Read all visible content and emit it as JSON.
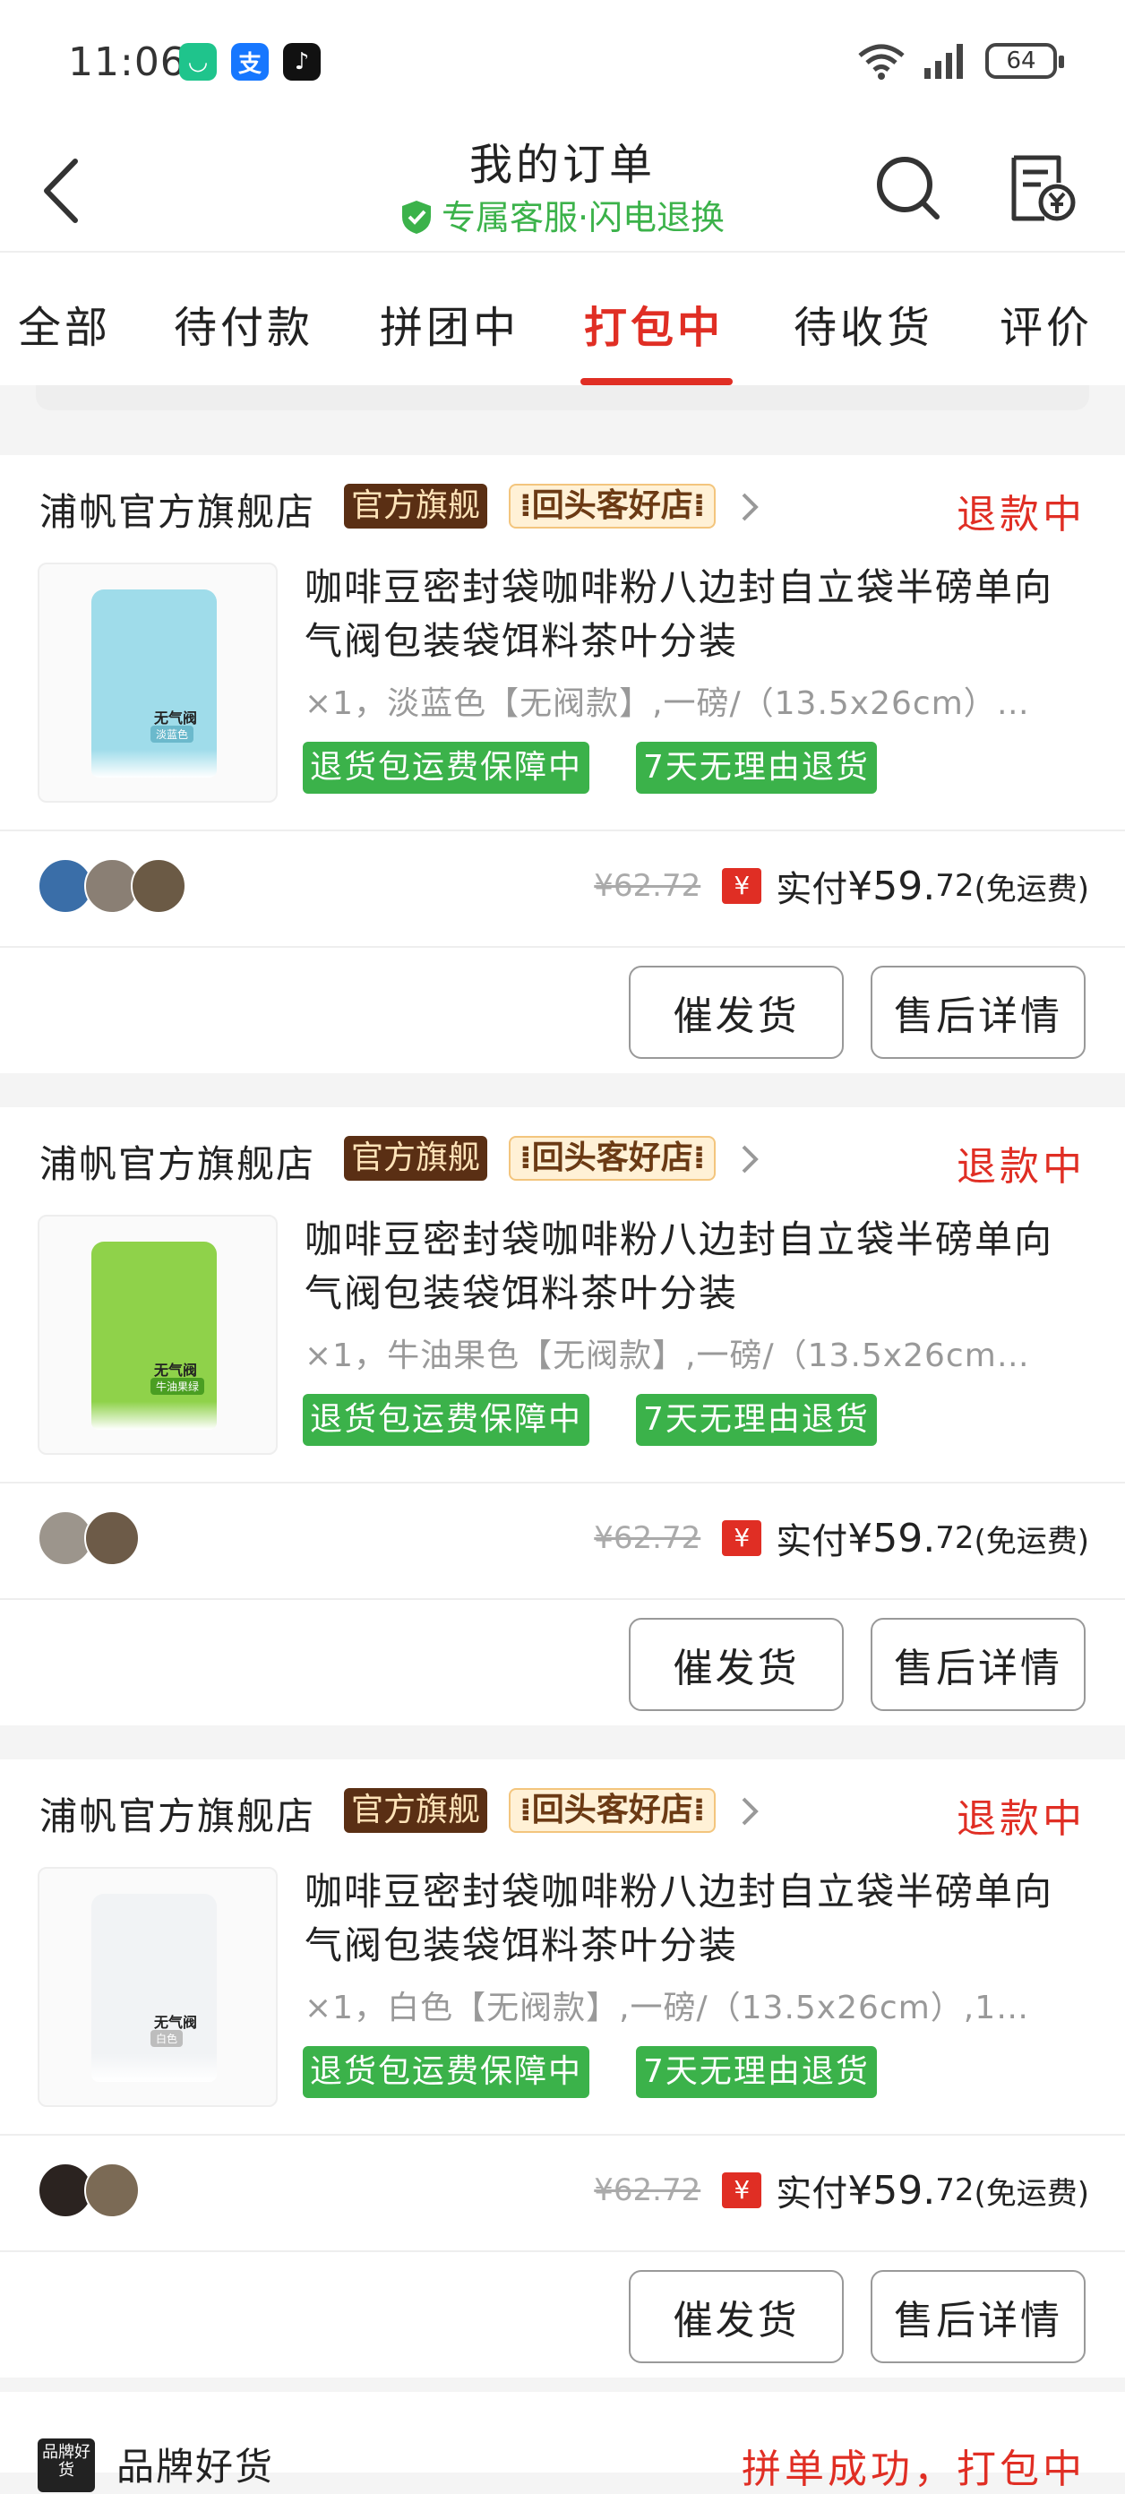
{
  "status_bar": {
    "time": "11:06",
    "apps": [
      {
        "icon": "app-icon-green",
        "glyph": "◡",
        "color": "#1fc48c"
      },
      {
        "icon": "alipay-icon",
        "glyph": "支",
        "color": "#1677ff"
      },
      {
        "icon": "tiktok-icon",
        "glyph": "♪",
        "color": "#111111"
      }
    ],
    "battery": "64"
  },
  "header": {
    "title": "我的订单",
    "subtitle": "专属客服·闪电退换"
  },
  "tabs": [
    {
      "label": "全部"
    },
    {
      "label": "待付款"
    },
    {
      "label": "拼团中"
    },
    {
      "label": "打包中"
    },
    {
      "label": "待收货"
    },
    {
      "label": "评价"
    }
  ],
  "orders": [
    {
      "store": "浦帆官方旗舰店",
      "badge_official": "官方旗舰",
      "badge_repeat": "回头客好店",
      "status": "退款中",
      "title": "咖啡豆密封袋咖啡粉八边封自立袋半磅单向气阀包装袋饵料茶叶分装",
      "spec": "×1，淡蓝色【无阀款】,一磅/（13.5x26cm）…",
      "bag_color": "#9fdcea",
      "bag_label": "无气阀",
      "bag_sub": "淡蓝色",
      "tag1": "退货包运费保障中",
      "tag2": "7天无理由退货",
      "orig_price": "¥62.72",
      "pay_label": "实付",
      "price_int": "¥59.",
      "price_dec": "72",
      "shipping": "(免运费)",
      "btn1": "催发货",
      "btn2": "售后详情"
    },
    {
      "store": "浦帆官方旗舰店",
      "badge_official": "官方旗舰",
      "badge_repeat": "回头客好店",
      "status": "退款中",
      "title": "咖啡豆密封袋咖啡粉八边封自立袋半磅单向气阀包装袋饵料茶叶分装",
      "spec": "×1，牛油果色【无阀款】,一磅/（13.5x26cm…",
      "bag_color": "#8fd24a",
      "bag_label": "无气阀",
      "bag_sub": "牛油果绿",
      "tag1": "退货包运费保障中",
      "tag2": "7天无理由退货",
      "orig_price": "¥62.72",
      "pay_label": "实付",
      "price_int": "¥59.",
      "price_dec": "72",
      "shipping": "(免运费)",
      "btn1": "催发货",
      "btn2": "售后详情"
    },
    {
      "store": "浦帆官方旗舰店",
      "badge_official": "官方旗舰",
      "badge_repeat": "回头客好店",
      "status": "退款中",
      "title": "咖啡豆密封袋咖啡粉八边封自立袋半磅单向气阀包装袋饵料茶叶分装",
      "spec": "×1，白色【无阀款】,一磅/（13.5x26cm）,1…",
      "bag_color": "#f1f3f5",
      "bag_label": "无气阀",
      "bag_sub": "白色",
      "tag1": "退货包运费保障中",
      "tag2": "7天无理由退货",
      "orig_price": "¥62.72",
      "pay_label": "实付",
      "price_int": "¥59.",
      "price_dec": "72",
      "shipping": "(免运费)",
      "btn1": "催发货",
      "btn2": "售后详情"
    }
  ],
  "partial_order": {
    "store": "品牌好货",
    "logo_text": "品牌好货",
    "status": "拼单成功，打包中"
  }
}
